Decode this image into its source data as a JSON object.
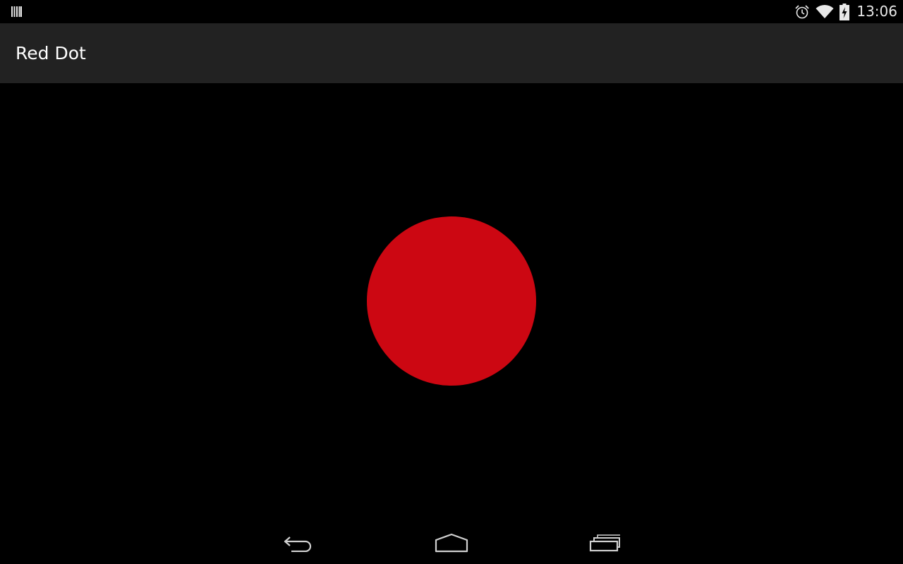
{
  "status_bar": {
    "time": "13:06",
    "icons": [
      "notification-icon",
      "alarm-icon",
      "wifi-icon",
      "battery-charging-icon"
    ]
  },
  "action_bar": {
    "title": "Red Dot"
  },
  "content": {
    "dot_color": "#cc0712",
    "dot_shape": "circle"
  },
  "nav_bar": {
    "buttons": [
      "back",
      "home",
      "recent-apps"
    ]
  },
  "colors": {
    "background": "#000000",
    "action_bar": "#222222",
    "title_text": "#ffffff",
    "status_icons": "#e8e8e8",
    "nav_icons": "#d0d0d0"
  }
}
